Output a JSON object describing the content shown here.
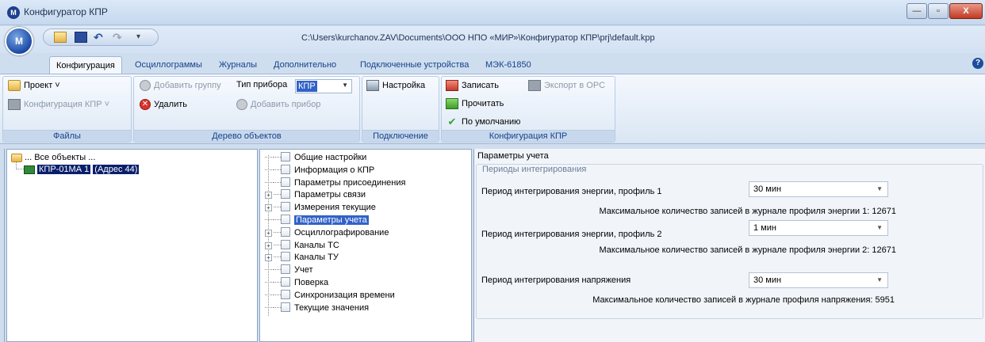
{
  "window": {
    "title": "Конфигуратор КПР",
    "path": "C:\\Users\\kurchanov.ZAV\\Documents\\ООО НПО «МИР»\\Конфигуратор КПР\\prj\\default.kpp",
    "controls": {
      "minimize": "—",
      "maximize": "▫",
      "close": "X"
    }
  },
  "tabs": [
    "Конфигурация",
    "Осциллограммы",
    "Журналы",
    "Дополнительно",
    "Подключенные устройства",
    "МЭК-61850"
  ],
  "ribbon": {
    "files": {
      "caption": "Файлы",
      "project": "Проект ˅",
      "kpr_config": "Конфигурация КПР ˅"
    },
    "tree": {
      "caption": "Дерево объектов",
      "add_group": "Добавить группу",
      "delete": "Удалить",
      "device_type_label": "Тип прибора",
      "device_type_value": "КПР",
      "add_device": "Добавить прибор"
    },
    "connection": {
      "caption": "Подключение",
      "settings": "Настройка"
    },
    "kpr": {
      "caption": "Конфигурация КПР",
      "write": "Записать",
      "read": "Прочитать",
      "default": "По умолчанию",
      "export": "Экспорт в OPC"
    }
  },
  "object_tree": {
    "root": "... Все объекты ...",
    "device": "КПР-01МА 1",
    "device_addr": "(Адрес 44)"
  },
  "nav_tree": [
    {
      "label": "Общие настройки",
      "expandable": false
    },
    {
      "label": "Информация о КПР",
      "expandable": false
    },
    {
      "label": "Параметры присоединения",
      "expandable": false
    },
    {
      "label": "Параметры связи",
      "expandable": true
    },
    {
      "label": "Измерения текущие",
      "expandable": true
    },
    {
      "label": "Параметры учета",
      "expandable": false,
      "selected": true
    },
    {
      "label": "Осциллографирование",
      "expandable": true
    },
    {
      "label": "Каналы ТС",
      "expandable": true
    },
    {
      "label": "Каналы ТУ",
      "expandable": true
    },
    {
      "label": "Учет",
      "expandable": false
    },
    {
      "label": "Поверка",
      "expandable": false
    },
    {
      "label": "Синхронизация времени",
      "expandable": false
    },
    {
      "label": "Текущие значения",
      "expandable": false
    }
  ],
  "form": {
    "title": "Параметры учета",
    "group_title": "Периоды интегрирования",
    "rows": [
      {
        "label": "Период интегрирования энергии, профиль 1",
        "value": "30 мин",
        "info": "Максимальное количество записей в журнале профиля энергии 1: 12671"
      },
      {
        "label": "Период интегрирования энергии, профиль 2",
        "value": "1 мин",
        "info": "Максимальное количество записей в журнале профиля энергии 2: 12671"
      },
      {
        "label": "Период интегрирования напряжения",
        "value": "30 мин",
        "info": "Максимальное количество записей в журнале профиля напряжения: 5951"
      }
    ]
  },
  "colors": {
    "selection": "#3162c7",
    "ribbon_text": "#15428b"
  }
}
